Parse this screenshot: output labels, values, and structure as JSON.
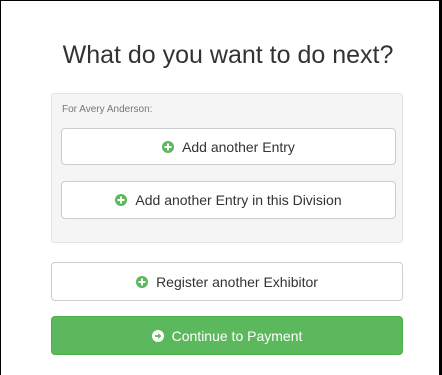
{
  "heading": "What do you want to do next?",
  "exhibitor_panel": {
    "label": "For Avery Anderson:",
    "add_entry_label": "Add another Entry",
    "add_entry_division_label": "Add another Entry in this Division"
  },
  "register_exhibitor_label": "Register another Exhibitor",
  "continue_payment_label": "Continue to Payment",
  "colors": {
    "success_green": "#5cb85c",
    "icon_green": "#5cb85c",
    "title_text": "#333333"
  }
}
